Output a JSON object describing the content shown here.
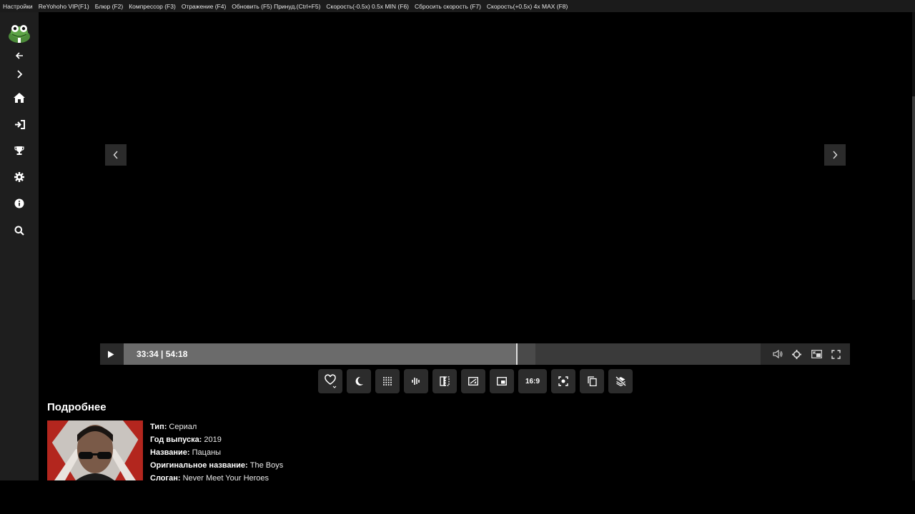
{
  "menubar": {
    "items": [
      "Настройки",
      "ReYohoho VIP(F1)",
      "Блюр (F2)",
      "Компрессор (F3)",
      "Отражение (F4)",
      "Обновить (F5) Принуд.(Ctrl+F5)",
      "Скорость(-0.5x) 0.5x MIN (F6)",
      "Сбросить скорость (F7)",
      "Скорость(+0.5x) 4x MAX (F8)"
    ]
  },
  "sidebar": {
    "icons": [
      "logo-frog-icon",
      "arrow-left-icon",
      "chevron-right-icon",
      "home-icon",
      "sign-in-icon",
      "trophy-icon",
      "gear-icon",
      "info-icon",
      "search-icon"
    ]
  },
  "player": {
    "time_current": "33:34",
    "time_total": "54:18",
    "time_display": "33:34 | 54:18",
    "played_fraction": 0.617,
    "buffered_fraction": 0.646,
    "aspect_label": "16:9"
  },
  "details": {
    "title": "Подробнее",
    "rows": [
      {
        "label": "Тип:",
        "value": " Сериал"
      },
      {
        "label": "Год выпуска:",
        "value": " 2019"
      },
      {
        "label": "Название:",
        "value": " Пацаны"
      },
      {
        "label": "Оригинальное название:",
        "value": " The Boys"
      },
      {
        "label": "Слоган:",
        "value": " Never Meet Your Heroes"
      }
    ]
  },
  "colors": {
    "background": "#000000",
    "sidebar": "#1e1e1e",
    "menubar": "#1b1b1b",
    "controls": "#2a2a2a",
    "played": "#6b6b6b"
  }
}
